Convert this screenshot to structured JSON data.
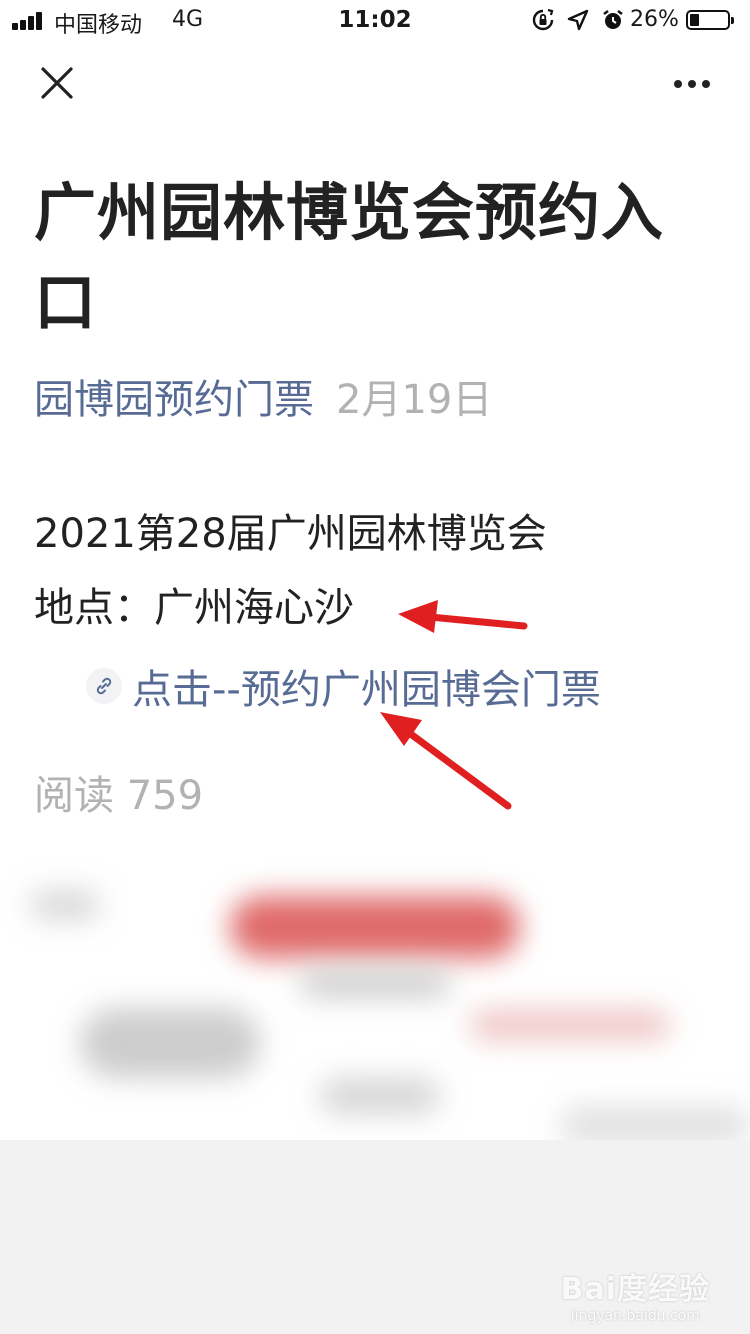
{
  "status_bar": {
    "carrier": "中国移动",
    "network": "4G",
    "time": "11:02",
    "battery_percent": "26%",
    "battery_level": 0.26,
    "icons": [
      "orientation-lock-icon",
      "location-icon",
      "alarm-icon"
    ]
  },
  "nav": {
    "close_icon": "close-icon",
    "more_icon": "more-icon"
  },
  "article": {
    "title": "广州园林博览会预约入口",
    "account_name": "园博园预约门票",
    "date": "2月19日",
    "paragraph_1": "2021第28届广州园林博览会",
    "paragraph_2": "地点：广州海心沙",
    "link_text": "点击--预约广州园博会门票",
    "reads": "阅读 759"
  },
  "colors": {
    "link": "#576b95",
    "muted": "#b2b2b2",
    "arrow": "#e02020"
  },
  "watermark": {
    "main": "Bai度经验",
    "sub": "jingyan.baidu.com"
  }
}
